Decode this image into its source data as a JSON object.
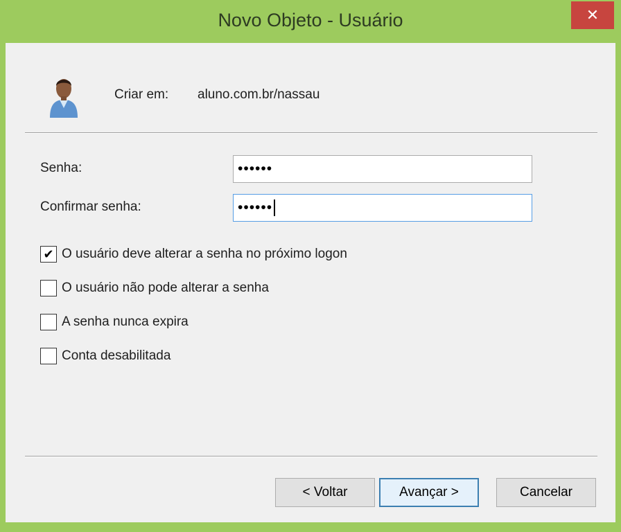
{
  "window": {
    "title": "Novo Objeto - Usuário",
    "close_label": "✕"
  },
  "header": {
    "create_in_label": "Criar em:",
    "create_in_value": "aluno.com.br/nassau"
  },
  "form": {
    "password_label": "Senha:",
    "password_value": "••••••",
    "confirm_label": "Confirmar senha:",
    "confirm_value": "••••••"
  },
  "options": [
    {
      "label": "O usuário deve alterar a senha no próximo logon",
      "checked": true,
      "mark": "✔"
    },
    {
      "label": "O usuário não pode alterar a senha",
      "checked": false,
      "mark": ""
    },
    {
      "label": "A senha nunca expira",
      "checked": false,
      "mark": ""
    },
    {
      "label": "Conta desabilitada",
      "checked": false,
      "mark": ""
    }
  ],
  "buttons": {
    "back": "< Voltar",
    "next": "Avançar >",
    "cancel": "Cancelar"
  },
  "colors": {
    "titlebar": "#9dcb5e",
    "close_button": "#c7453f",
    "focus_border": "#569de5"
  },
  "icons": {
    "user": "user-icon"
  }
}
